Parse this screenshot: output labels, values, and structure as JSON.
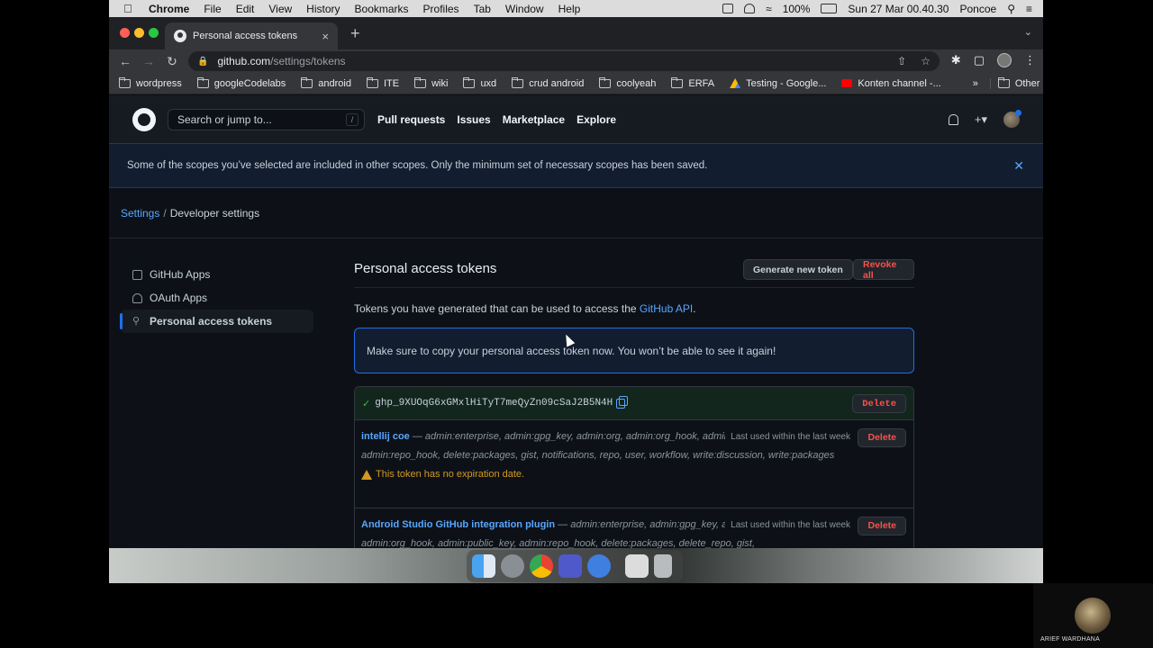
{
  "menubar": {
    "app": "Chrome",
    "items": [
      "File",
      "Edit",
      "View",
      "History",
      "Bookmarks",
      "Profiles",
      "Tab",
      "Window",
      "Help"
    ],
    "battery": "100%",
    "clock": "Sun 27 Mar  00.40.30",
    "user": "Poncoe"
  },
  "browser": {
    "tab_title": "Personal access tokens",
    "url_host": "github.com",
    "url_path": "/settings/tokens",
    "bookmarks": [
      "wordpress",
      "googleCodelabs",
      "android",
      "ITE",
      "wiki",
      "uxd",
      "crud android",
      "coolyeah",
      "ERFA",
      "Testing - Google...",
      "Konten channel -..."
    ],
    "more": "»",
    "other_bookmarks": "Other Bookmarks"
  },
  "github": {
    "search_placeholder": "Search or jump to...",
    "search_key": "/",
    "nav": [
      "Pull requests",
      "Issues",
      "Marketplace",
      "Explore"
    ]
  },
  "flash": {
    "message": "Some of the scopes you’ve selected are included in other scopes. Only the minimum set of necessary scopes has been saved."
  },
  "breadcrumb": {
    "settings": "Settings",
    "sep": "/",
    "current": "Developer settings"
  },
  "sidebar": {
    "items": [
      {
        "label": "GitHub Apps"
      },
      {
        "label": "OAuth Apps"
      },
      {
        "label": "Personal access tokens"
      }
    ]
  },
  "main": {
    "title": "Personal access tokens",
    "generate_btn": "Generate new token",
    "revoke_btn": "Revoke all",
    "desc_prefix": "Tokens you have generated that can be used to access the ",
    "desc_link": "GitHub API",
    "desc_suffix": ".",
    "notice": "Make sure to copy your personal access token now. You won’t be able to see it again!",
    "new_token": "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",
    "delete_label": "Delete",
    "tokens": [
      {
        "name": "intellij coe",
        "dash": " — ",
        "scopes": "admin:enterprise, admin:gpg_key, admin:org, admin:org_hook, admin:public_key, admin:repo_hook, delete:packages, gist, notifications, repo, user, workflow, write:discussion, write:packages",
        "last_used": "Last used within the last week",
        "warning": "This token has no expiration date."
      },
      {
        "name": "Android Studio GitHub integration plugin",
        "dash": " — ",
        "scopes": "admin:enterprise, admin:gpg_key, admin:org, admin:org_hook, admin:public_key, admin:repo_hook, delete:packages, delete_repo, gist,",
        "last_used": "Last used within the last week"
      }
    ]
  },
  "participant": {
    "name": "ARIEF WARDHANA"
  }
}
